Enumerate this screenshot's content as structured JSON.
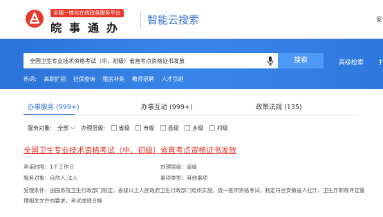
{
  "header": {
    "brand_badge": "全国一体化在线政务服务平台",
    "brand_name": "皖事通办",
    "brand_sub": "智能云搜索",
    "right_edge": "安"
  },
  "search": {
    "query": "全国卫生专业技术资格考试（中、初级）省直考点资格证书发放",
    "button": "搜索",
    "advanced": "高级检索",
    "band_edge": "扌",
    "hot_label": "热词:",
    "hot_words": [
      "高职扩招",
      "社保查询",
      "租房补贴",
      "教师招聘",
      "人才引进"
    ]
  },
  "tabs": [
    {
      "label": "办事服务 (999+)",
      "active": true
    },
    {
      "label": "办事互动 (999+)",
      "active": false
    },
    {
      "label": "政策法规 (135)",
      "active": false
    }
  ],
  "filters": {
    "object_label": "服务对象:",
    "object_value": "全部",
    "level_label": "办理层级:",
    "levels": [
      "省级",
      "市级",
      "县级",
      "乡级",
      "村级"
    ]
  },
  "result": {
    "title": "全国卫生专业技术资格考试（中、初级）省直考点资格证书发放",
    "time_limit": "承诺时限：1个工作日",
    "handle_level": "办理层级：省级",
    "service_object": "服务对象：自然人,法人",
    "matter_type": "事项类型：其他事项",
    "conditions": "受理条件：由国务院卫生行政部门制定，省级以上人民政府卫生行政部门组织实施。统一医师资格考试，制定符合安徽省人社厅、卫生厅职称评定管理相关文件的要求，考试成绩合格"
  },
  "colors": {
    "brand_red": "#e63b2e",
    "accent_blue": "#2f6fd3",
    "band_blue": "#2f7ae0",
    "result_red": "#e23127"
  }
}
